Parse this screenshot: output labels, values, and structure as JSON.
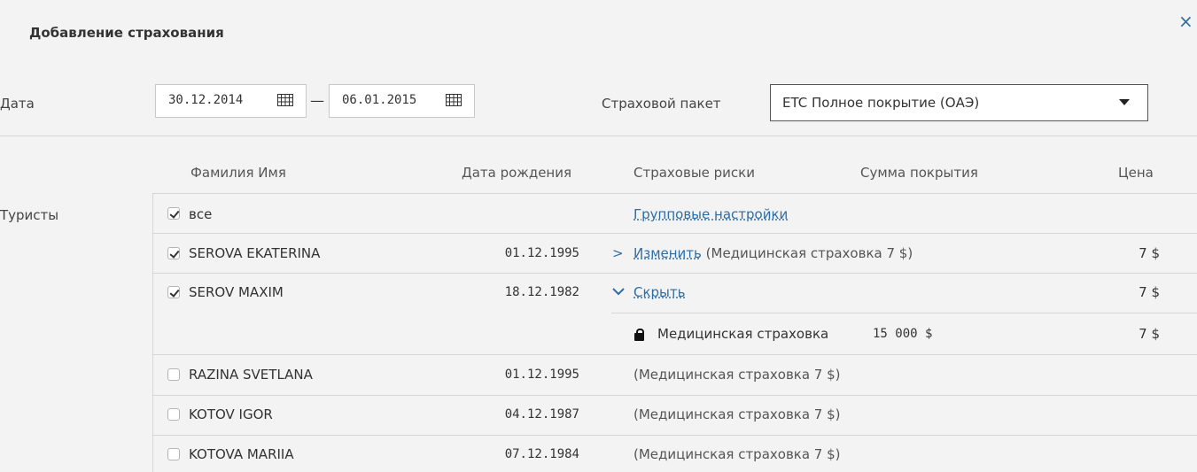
{
  "dialog": {
    "title": "Добавление страхования",
    "close": "×"
  },
  "dates": {
    "label": "Дата",
    "from": "30.12.2014",
    "separator": "—",
    "to": "06.01.2015"
  },
  "package": {
    "label": "Страховой пакет",
    "value": "ETC Полное покрытие (ОАЭ)"
  },
  "table": {
    "headers": {
      "name": "Фамилия Имя",
      "dob": "Дата рождения",
      "risks": "Страховые риски",
      "coverage": "Сумма покрытия",
      "price": "Цена"
    },
    "tourists_label": "Туристы",
    "all_row": {
      "label": "все",
      "checked": true,
      "group_link": "Групповые настройки"
    },
    "rows": [
      {
        "name": "SEROVA EKATERINA",
        "dob": "01.12.1995",
        "checked": true,
        "toggle": ">",
        "link": "Изменить",
        "risk": "(Медицинская страховка 7 $)",
        "price": "7 $"
      },
      {
        "name": "SEROV MAXIM",
        "dob": "18.12.1982",
        "checked": true,
        "toggle": "v",
        "link": "Скрыть",
        "risk": "",
        "price": "7 $",
        "detail": {
          "risk": "Медицинская страховка",
          "coverage": "15 000 $",
          "price": "7 $"
        }
      },
      {
        "name": "RAZINA SVETLANA",
        "dob": "01.12.1995",
        "checked": false,
        "risk": "(Медицинская страховка 7 $)"
      },
      {
        "name": "KOTOV IGOR",
        "dob": "04.12.1987",
        "checked": false,
        "risk": "(Медицинская страховка 7 $)"
      },
      {
        "name": "KOTOVA MARIIA",
        "dob": "07.12.1984",
        "checked": false,
        "risk": "(Медицинская страховка 7 $)"
      }
    ]
  },
  "icons": {
    "calendar": "calendar-icon",
    "close": "close-icon",
    "caret": "chevron-down-icon",
    "expand": "chevron-right-icon",
    "collapse": "chevron-down-icon",
    "lock": "lock-icon"
  },
  "colors": {
    "background": "#f3f3f3",
    "link": "#2e6da4",
    "border": "#d6d6d6"
  }
}
